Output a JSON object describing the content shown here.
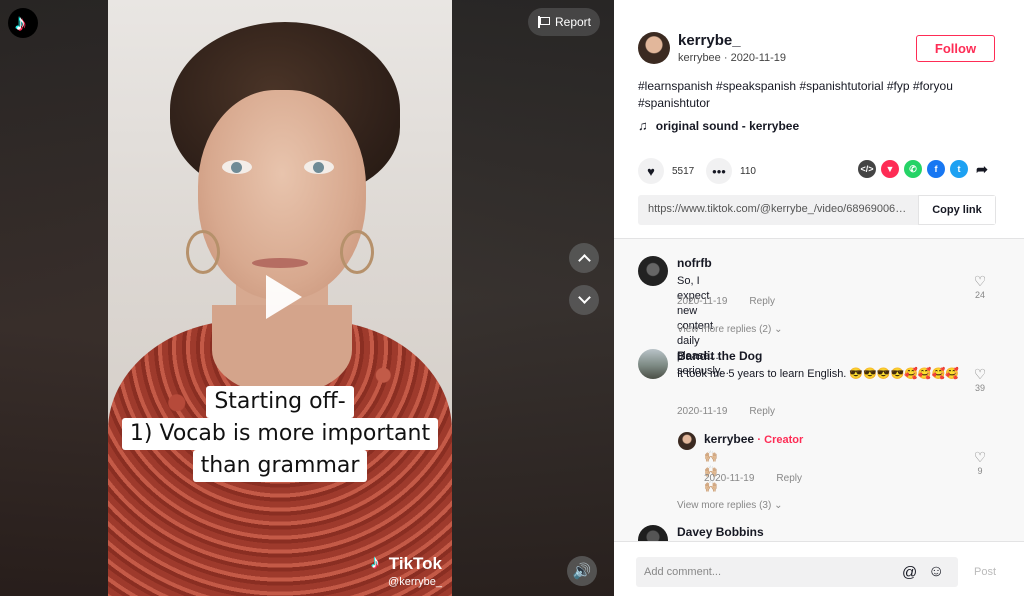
{
  "video": {
    "report_label": "Report",
    "captions": [
      "Starting off-",
      "1) Vocab is more important",
      "than grammar"
    ],
    "watermark_brand": "TikTok",
    "watermark_handle": "@kerrybe_"
  },
  "author": {
    "username": "kerrybe_",
    "subline": "kerrybee · 2020-11-19",
    "follow_label": "Follow"
  },
  "post": {
    "hashtags": "#learnspanish #speakspanish #spanishtutorial #fyp #foryou #spanishtutor",
    "sound": "original sound - kerrybee",
    "likes": "5517",
    "comments": "110",
    "link": "https://www.tiktok.com/@kerrybe_/video/689690063424...",
    "copy_label": "Copy link"
  },
  "share_icons": [
    "embed-icon",
    "send-icon",
    "whatsapp-icon",
    "facebook-icon",
    "twitter-icon",
    "forward-icon"
  ],
  "colors": {
    "accent": "#fe2c55",
    "text": "#161823",
    "muted": "#888888"
  },
  "comments": [
    {
      "name": "nofrfb",
      "text": "So, I expect new content daily please.... seriously...",
      "date": "2020-11-19",
      "reply": "Reply",
      "likes": "24",
      "view_more": "View more replies (2)"
    },
    {
      "name": "Bandit the Dog",
      "text": "It took me 5 years to learn English. 😎😎😎😎🥰🥰🥰🥰",
      "date": "2020-11-19",
      "reply": "Reply",
      "likes": "39",
      "sub": {
        "name": "kerrybee",
        "badge": "Creator",
        "text": "🙌🏼🙌🏼🙌🏼",
        "date": "2020-11-19",
        "reply": "Reply",
        "likes": "9"
      },
      "view_more": "View more replies (3)"
    },
    {
      "name": "Davey Bobbins"
    }
  ],
  "composer": {
    "placeholder": "Add comment...",
    "post_label": "Post"
  }
}
